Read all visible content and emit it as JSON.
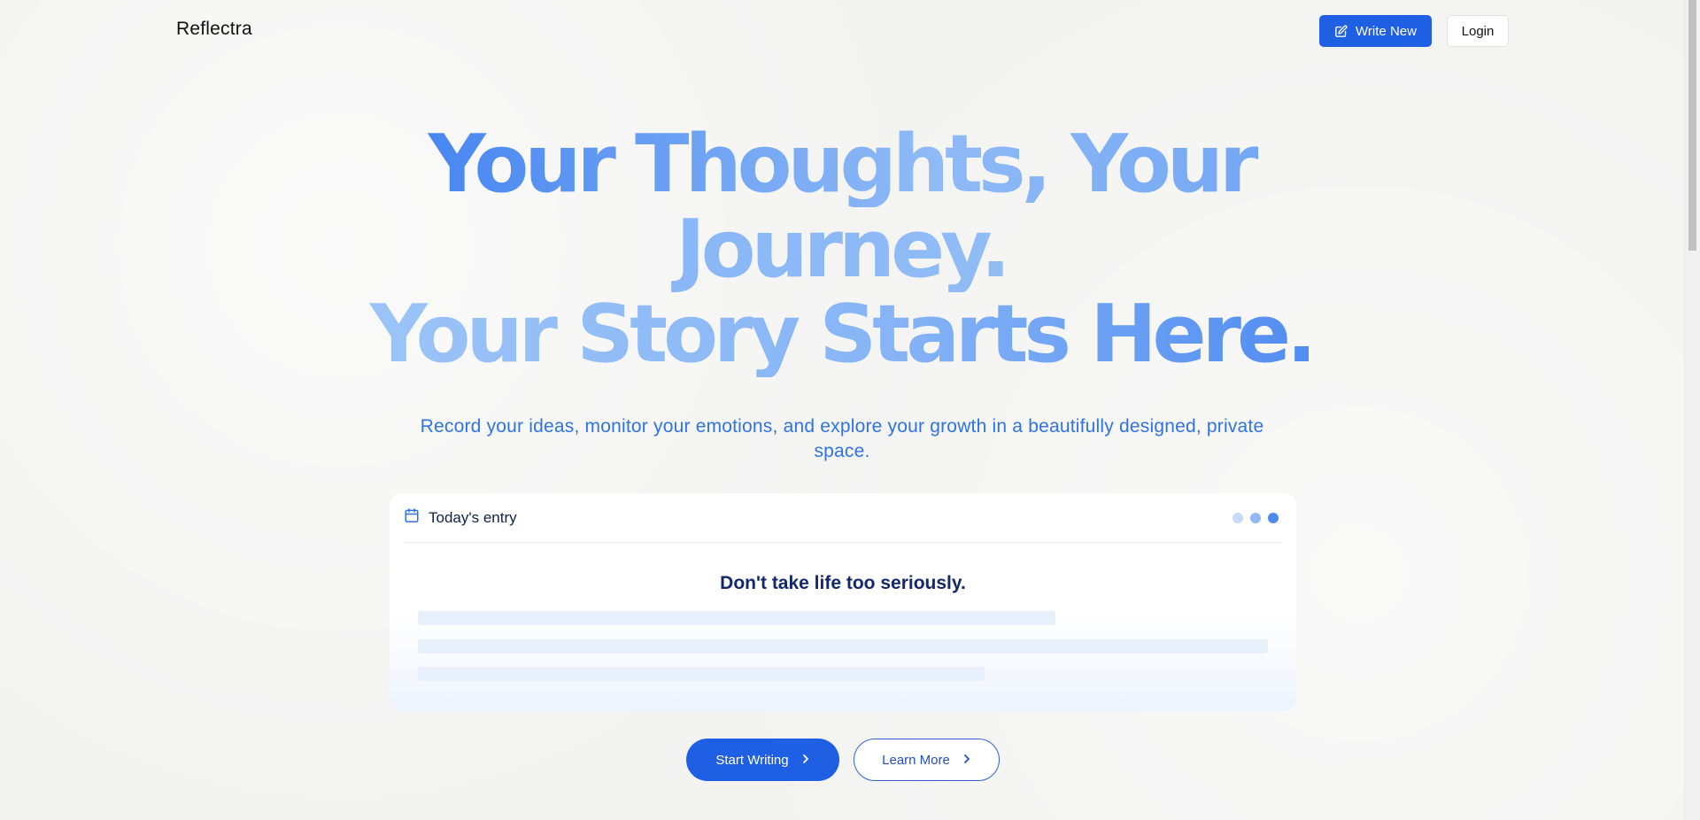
{
  "header": {
    "brand": "Reflectra",
    "write_new_label": "Write New",
    "login_label": "Login"
  },
  "hero": {
    "line1": "Your Thoughts, Your",
    "line2": "Journey.",
    "line3": "Your Story Starts Here.",
    "subtitle": "Record your ideas, monitor your emotions, and explore your growth in a beautifully designed, private space."
  },
  "card": {
    "title": "Today's entry",
    "quote": "Don't take life too seriously."
  },
  "cta": {
    "start_label": "Start Writing",
    "learn_label": "Learn More"
  },
  "colors": {
    "accent": "#1f5fe3",
    "hero_blue": "#3d7ef0",
    "subtitle_blue": "#2f73e6"
  },
  "icons": {
    "write_new": "edit-icon",
    "card": "calendar-icon",
    "cta": "chevron-right-icon"
  }
}
